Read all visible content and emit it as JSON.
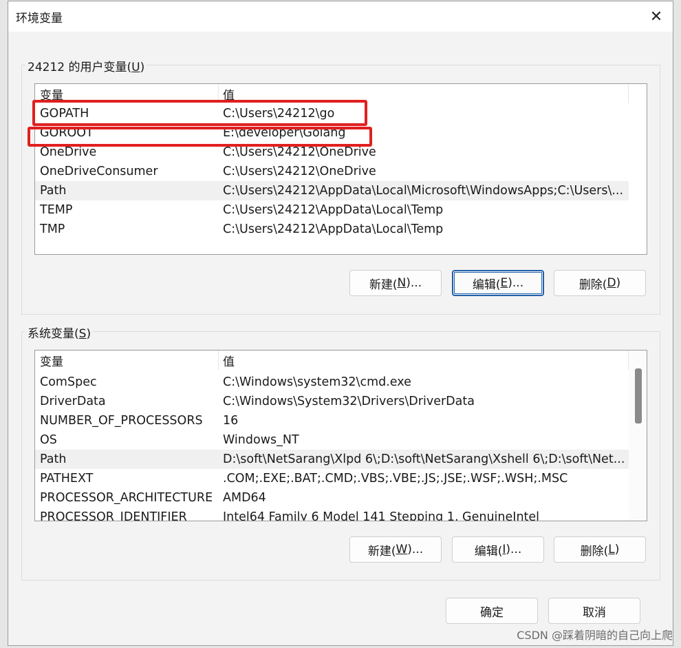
{
  "window": {
    "title": "环境变量",
    "close": "✕"
  },
  "user_vars": {
    "group_label": "24212 的用户变量(",
    "group_key": "U",
    "group_tail": ")",
    "col_var": "变量",
    "col_val": "值",
    "rows": [
      {
        "name": "GOPATH",
        "value": "C:\\Users\\24212\\go"
      },
      {
        "name": "GOROOT",
        "value": "E:\\developer\\Golang"
      },
      {
        "name": "OneDrive",
        "value": "C:\\Users\\24212\\OneDrive"
      },
      {
        "name": "OneDriveConsumer",
        "value": "C:\\Users\\24212\\OneDrive"
      },
      {
        "name": "Path",
        "value": "C:\\Users\\24212\\AppData\\Local\\Microsoft\\WindowsApps;C:\\Users\\..."
      },
      {
        "name": "TEMP",
        "value": "C:\\Users\\24212\\AppData\\Local\\Temp"
      },
      {
        "name": "TMP",
        "value": "C:\\Users\\24212\\AppData\\Local\\Temp"
      }
    ],
    "buttons": {
      "new": {
        "pre": "新建(",
        "key": "N",
        "post": ")..."
      },
      "edit": {
        "pre": "编辑(",
        "key": "E",
        "post": ")..."
      },
      "delete": {
        "pre": "删除(",
        "key": "D",
        "post": ")"
      }
    }
  },
  "system_vars": {
    "group_label": "系统变量(",
    "group_key": "S",
    "group_tail": ")",
    "col_var": "变量",
    "col_val": "值",
    "rows": [
      {
        "name": "ComSpec",
        "value": "C:\\Windows\\system32\\cmd.exe"
      },
      {
        "name": "DriverData",
        "value": "C:\\Windows\\System32\\Drivers\\DriverData"
      },
      {
        "name": "NUMBER_OF_PROCESSORS",
        "value": "16"
      },
      {
        "name": "OS",
        "value": "Windows_NT"
      },
      {
        "name": "Path",
        "value": "D:\\soft\\NetSarang\\Xlpd 6\\;D:\\soft\\NetSarang\\Xshell 6\\;D:\\soft\\Net..."
      },
      {
        "name": "PATHEXT",
        "value": ".COM;.EXE;.BAT;.CMD;.VBS;.VBE;.JS;.JSE;.WSF;.WSH;.MSC"
      },
      {
        "name": "PROCESSOR_ARCHITECTURE",
        "value": "AMD64"
      },
      {
        "name": "PROCESSOR_IDENTIFIER",
        "value": "Intel64 Family 6 Model 141 Stepping 1, GenuineIntel"
      }
    ],
    "buttons": {
      "new": {
        "pre": "新建(",
        "key": "W",
        "post": ")..."
      },
      "edit": {
        "pre": "编辑(",
        "key": "I",
        "post": ")..."
      },
      "delete": {
        "pre": "删除(",
        "key": "L",
        "post": ")"
      }
    }
  },
  "footer": {
    "ok": "确定",
    "cancel": "取消"
  },
  "watermark": "CSDN @踩着阴暗的自己向上爬",
  "colors": {
    "highlight": "#e0201f",
    "focus": "#1f5fa8"
  }
}
